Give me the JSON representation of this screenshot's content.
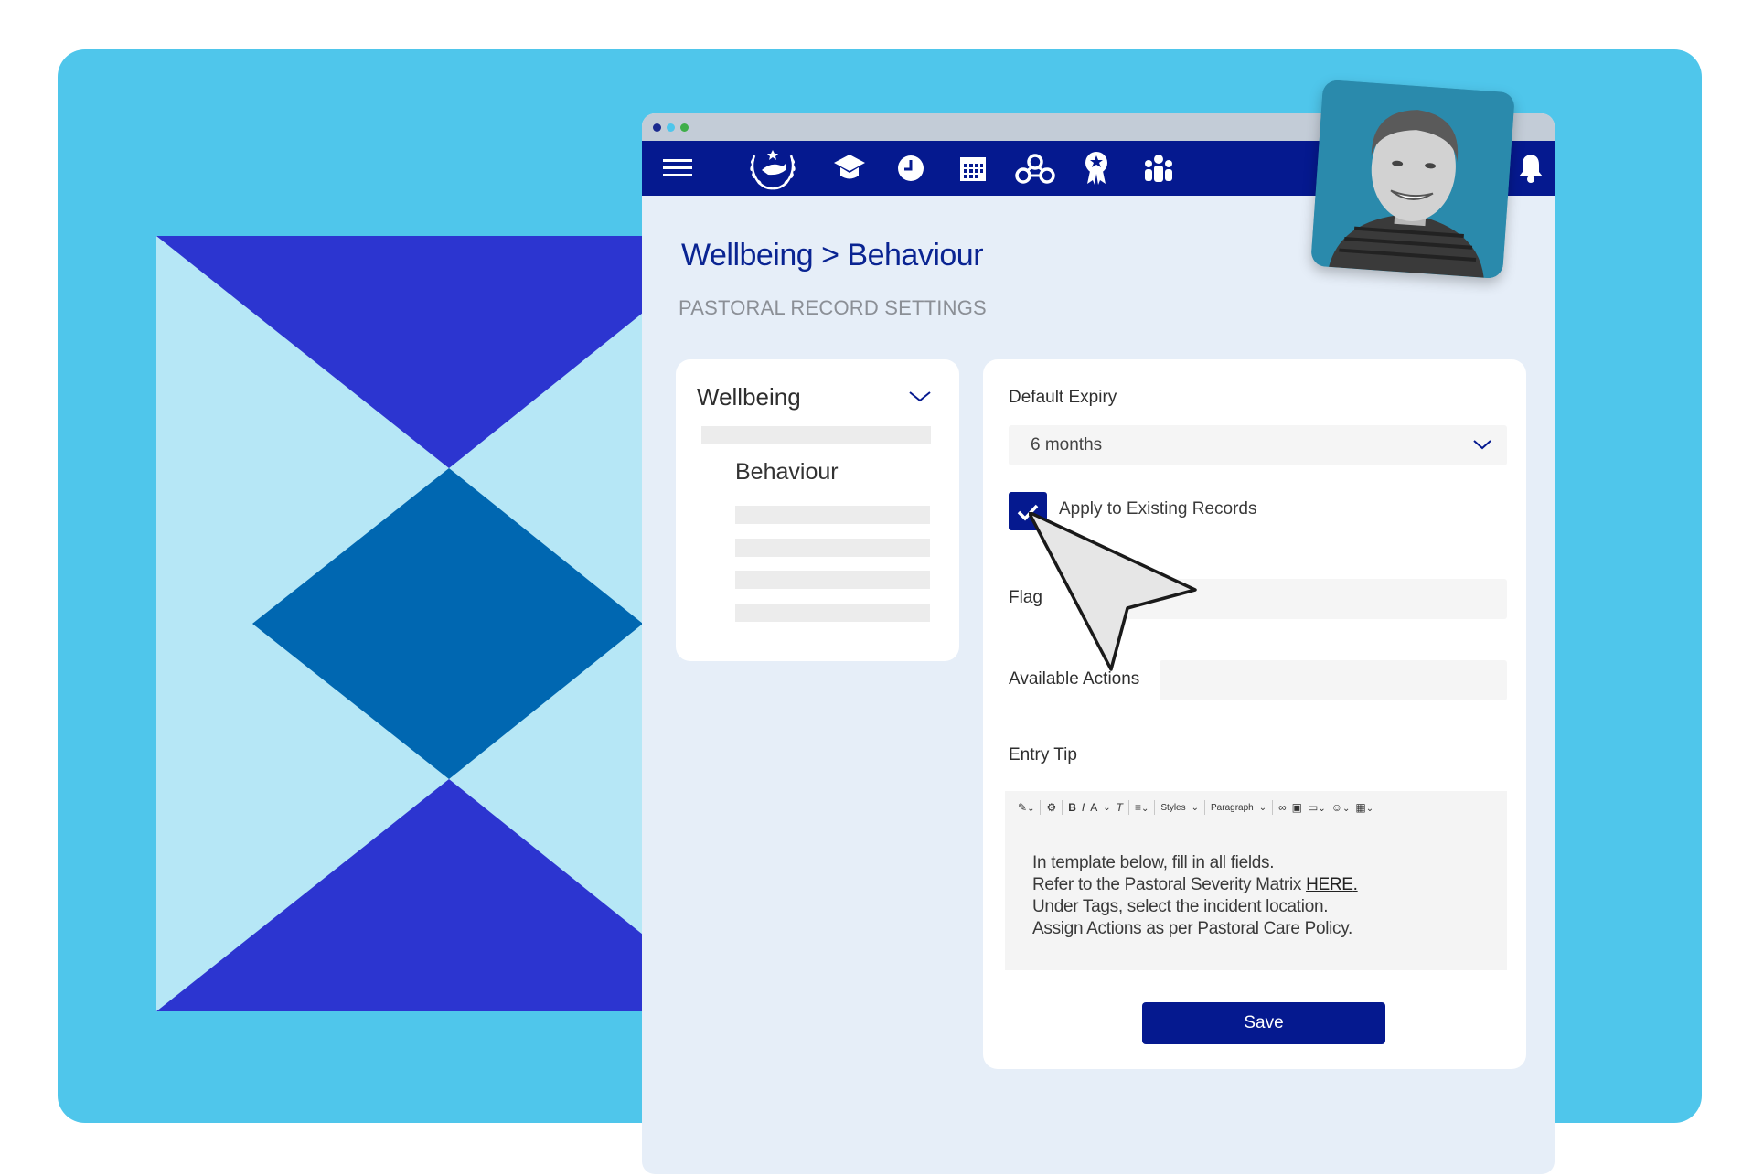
{
  "colors": {
    "canvas": "#4fc6eb",
    "brand_navy": "#05198f",
    "window_bg": "#e6eef8",
    "heading_blue": "#0a2492",
    "deco_royal": "#2c35d0",
    "deco_light": "#b6e7f6",
    "deco_mid": "#0067b1"
  },
  "window": {
    "dots": [
      "#1b2a8f",
      "#4fc6eb",
      "#3fae49"
    ]
  },
  "navbar": {
    "icons": [
      "menu-icon",
      "school-crest-logo",
      "graduation-cap-icon",
      "clock-icon",
      "calendar-icon",
      "network-icon",
      "award-ribbon-icon",
      "people-icon",
      "notification-bell-icon"
    ]
  },
  "page": {
    "breadcrumb": "Wellbeing > Behaviour",
    "subtitle": "PASTORAL RECORD SETTINGS"
  },
  "sidebar": {
    "section_title": "Wellbeing",
    "selected_item": "Behaviour"
  },
  "form": {
    "default_expiry_label": "Default Expiry",
    "default_expiry_value": "6 months",
    "apply_existing_label": "Apply to Existing Records",
    "apply_existing_checked": true,
    "flag_label": "Flag",
    "available_actions_label": "Available Actions",
    "entry_tip_label": "Entry Tip",
    "toolbar": {
      "bold": "B",
      "italic": "I",
      "font_size": "A",
      "clear_format": "T",
      "styles": "Styles",
      "paragraph": "Paragraph"
    },
    "entry_tip_lines": [
      "In template below, fill in all fields.",
      "Refer to the Pastoral Severity Matrix",
      "Under Tags, select the incident location.",
      "Assign Actions as per Pastoral Care Policy."
    ],
    "entry_tip_link": "HERE",
    "entry_tip_link_suffix": ".",
    "save_label": "Save"
  }
}
